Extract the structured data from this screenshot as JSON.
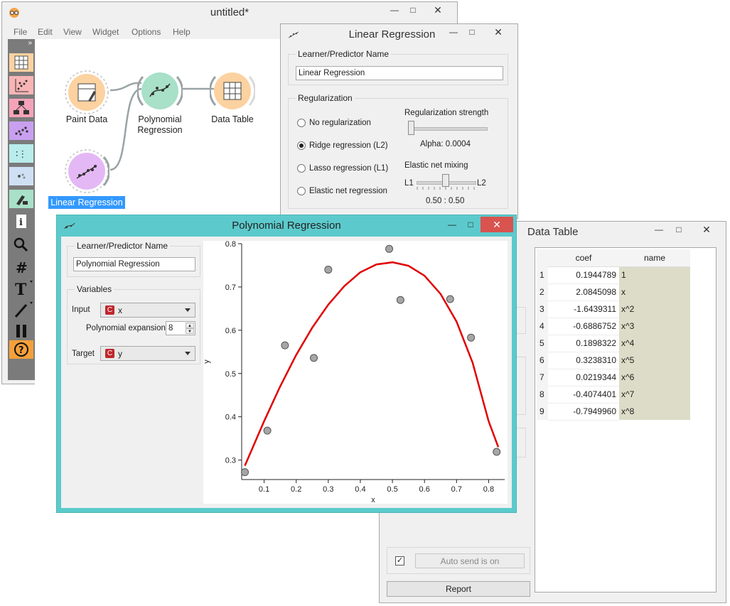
{
  "canvas": {
    "title": "untitled*",
    "menu": [
      "File",
      "Edit",
      "View",
      "Widget",
      "Options",
      "Help"
    ],
    "toolbar_icons": [
      "data-icon",
      "visualize-icon",
      "model-icon",
      "unsupervised-icon",
      "evaluate-icon",
      "widget-category-icon",
      "add-ons-icon",
      "info-icon",
      "search-icon",
      "grid-icon",
      "text-annotation-icon",
      "arrow-annotation-icon",
      "pause-icon",
      "help-icon"
    ],
    "nodes": {
      "paint_data": "Paint Data",
      "poly_line1": "Polynomial",
      "poly_line2": "Regression",
      "data_table": "Data Table",
      "linear_regression": "Linear Regression"
    }
  },
  "linear_regression": {
    "title": "Linear Regression",
    "name_group": "Learner/Predictor Name",
    "name_value": "Linear Regression",
    "reg_group": "Regularization",
    "options": [
      "No regularization",
      "Ridge regression (L2)",
      "Lasso regression (L1)",
      "Elastic net regression"
    ],
    "selected_index": 1,
    "strength_label": "Regularization strength",
    "alpha_text": "Alpha: 0.0004",
    "mixing_label": "Elastic net mixing",
    "l1": "L1",
    "l2": "L2",
    "mixing_value": "0.50 : 0.50",
    "strength_fraction": 0.0,
    "mixing_fraction": 0.5
  },
  "data_table": {
    "title": "Data Table",
    "headers": [
      "coef",
      "name"
    ],
    "rows": [
      {
        "n": "1",
        "coef": "0.1944789",
        "name": "1"
      },
      {
        "n": "2",
        "coef": "2.0845098",
        "name": "x"
      },
      {
        "n": "3",
        "coef": "-1.6439311",
        "name": "x^2"
      },
      {
        "n": "4",
        "coef": "-0.6886752",
        "name": "x^3"
      },
      {
        "n": "5",
        "coef": "0.1898322",
        "name": "x^4"
      },
      {
        "n": "6",
        "coef": "0.3238310",
        "name": "x^5"
      },
      {
        "n": "7",
        "coef": "0.0219344",
        "name": "x^6"
      },
      {
        "n": "8",
        "coef": "-0.4074401",
        "name": "x^7"
      },
      {
        "n": "9",
        "coef": "-0.7949960",
        "name": "x^8"
      }
    ],
    "auto_send": "Auto send is on",
    "auto_send_checked": true,
    "report": "Report"
  },
  "polynomial_regression": {
    "title": "Polynomial Regression",
    "name_group": "Learner/Predictor Name",
    "name_value": "Polynomial Regression",
    "variables_group": "Variables",
    "input_label": "Input",
    "input_badge": "C",
    "input_value": "x",
    "expansion_label": "Polynomial expansion:",
    "expansion_value": "8",
    "target_label": "Target",
    "target_badge": "C",
    "target_value": "y"
  },
  "chart_data": {
    "type": "scatter",
    "xlabel": "x",
    "ylabel": "y",
    "xlim": [
      0.03,
      0.85
    ],
    "ylim": [
      0.255,
      0.8
    ],
    "xticks": [
      0.1,
      0.2,
      0.3,
      0.4,
      0.5,
      0.6,
      0.7,
      0.8
    ],
    "yticks": [
      0.3,
      0.4,
      0.5,
      0.6,
      0.7,
      0.8
    ],
    "points": [
      {
        "x": 0.04,
        "y": 0.272
      },
      {
        "x": 0.11,
        "y": 0.368
      },
      {
        "x": 0.165,
        "y": 0.565
      },
      {
        "x": 0.255,
        "y": 0.536
      },
      {
        "x": 0.3,
        "y": 0.74
      },
      {
        "x": 0.49,
        "y": 0.788
      },
      {
        "x": 0.525,
        "y": 0.67
      },
      {
        "x": 0.68,
        "y": 0.672
      },
      {
        "x": 0.745,
        "y": 0.583
      },
      {
        "x": 0.825,
        "y": 0.319
      }
    ],
    "curve": {
      "x": [
        0.04,
        0.1,
        0.15,
        0.2,
        0.25,
        0.3,
        0.35,
        0.4,
        0.45,
        0.5,
        0.55,
        0.6,
        0.65,
        0.7,
        0.75,
        0.8,
        0.83
      ],
      "y": [
        0.287,
        0.39,
        0.47,
        0.543,
        0.606,
        0.659,
        0.702,
        0.734,
        0.752,
        0.757,
        0.749,
        0.726,
        0.684,
        0.62,
        0.525,
        0.39,
        0.33
      ]
    },
    "point_color": "#a6a6a6",
    "curve_color": "#e00000"
  },
  "colors": {
    "accent_teal": "#5ccacc",
    "selection_blue": "#3399ff",
    "close_red": "#d9534f",
    "name_column_bg": "#dcdcc8"
  }
}
